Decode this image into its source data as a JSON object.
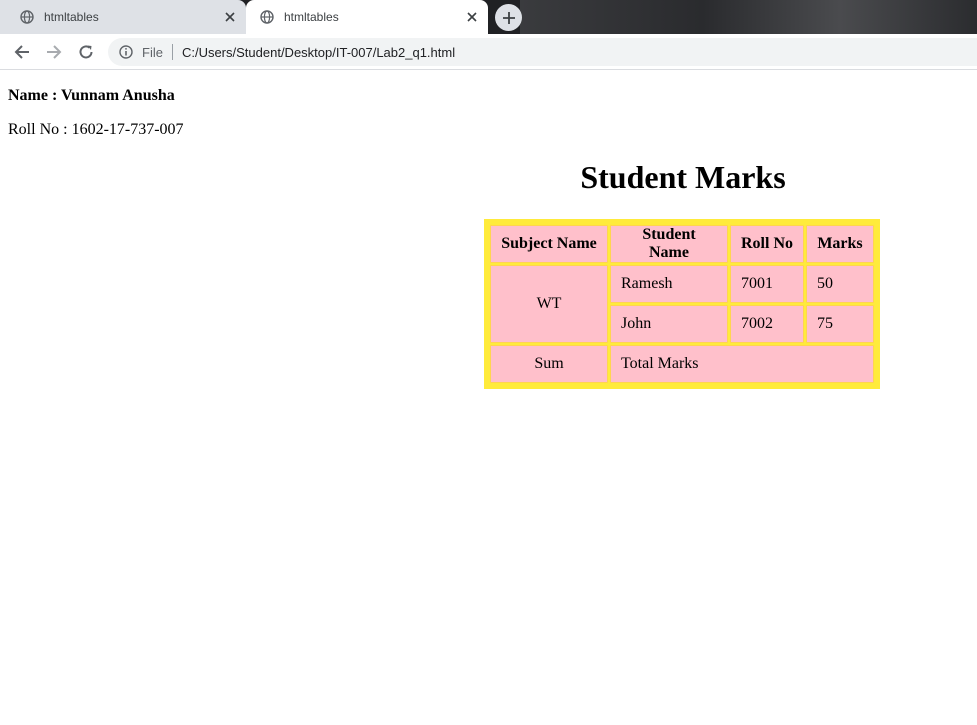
{
  "browser": {
    "tabs": [
      {
        "title": "htmltables",
        "active": false
      },
      {
        "title": "htmltables",
        "active": true
      }
    ],
    "omnibox": {
      "scheme_label": "File",
      "url": "C:/Users/Student/Desktop/IT-007/Lab2_q1.html"
    },
    "icons": {
      "back": "back-arrow-icon",
      "forward": "forward-arrow-icon",
      "reload": "reload-icon",
      "info": "info-icon",
      "new_tab": "plus-icon",
      "favicon": "globe-icon",
      "close": "close-icon"
    }
  },
  "page": {
    "name_line": "Name : Vunnam Anusha",
    "roll_line": "Roll No : 1602-17-737-007",
    "heading": "Student Marks",
    "table": {
      "headers": [
        "Subject Name",
        "Student Name",
        "Roll No",
        "Marks"
      ],
      "subject": "WT",
      "rows": [
        {
          "student": "Ramesh",
          "roll": "7001",
          "marks": "50"
        },
        {
          "student": "John",
          "roll": "7002",
          "marks": "75"
        }
      ],
      "footer": {
        "label": "Sum",
        "value": "Total Marks"
      }
    }
  },
  "colors": {
    "table_border": "#ffeb3b",
    "cell_background": "#ffc0cb"
  }
}
